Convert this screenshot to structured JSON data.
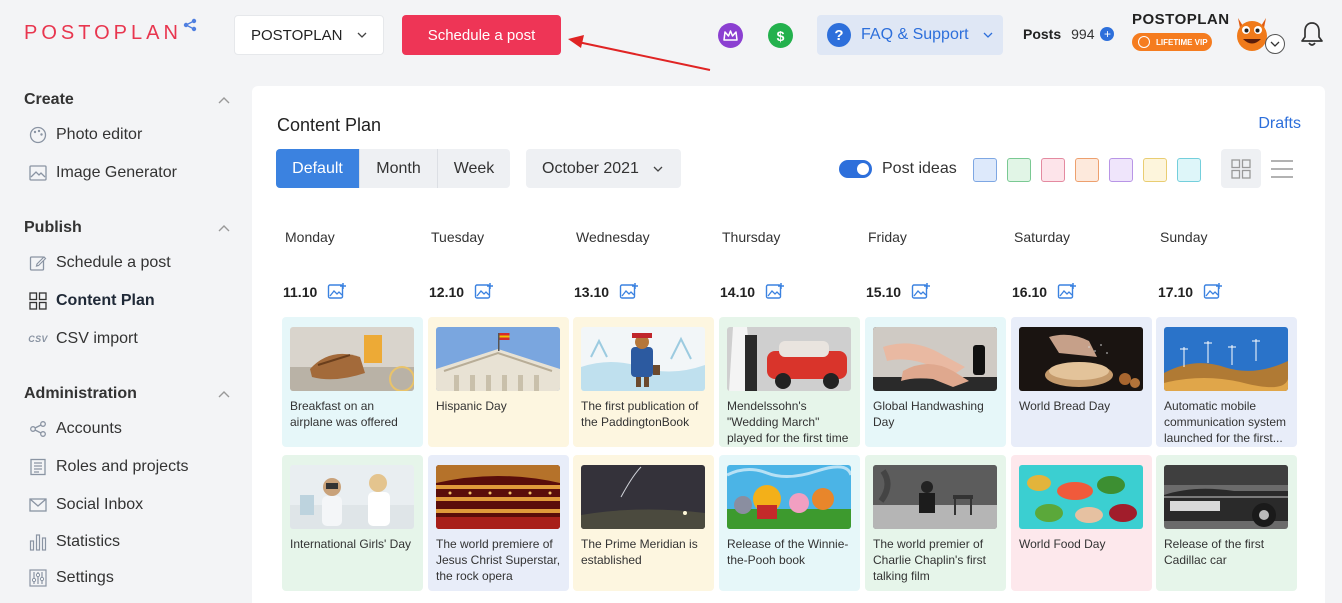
{
  "header": {
    "logo": "POSTOPLAN",
    "project_select": "POSTOPLAN",
    "schedule_button": "Schedule a post",
    "faq_label": "FAQ & Support",
    "posts_label": "Posts",
    "posts_count": "994",
    "brand_name": "POSTOPLAN",
    "vip_badge": "LIFETIME VIP"
  },
  "sidebar": {
    "create": {
      "title": "Create",
      "items": [
        "Photo editor",
        "Image Generator"
      ]
    },
    "publish": {
      "title": "Publish",
      "items": [
        "Schedule a post",
        "Content Plan",
        "CSV import"
      ]
    },
    "administration": {
      "title": "Administration",
      "items": [
        "Accounts",
        "Roles and projects",
        "Social Inbox",
        "Statistics",
        "Settings"
      ]
    },
    "csv_icon_text": "CSV"
  },
  "content": {
    "title": "Content Plan",
    "drafts": "Drafts",
    "tabs": [
      "Default",
      "Month",
      "Week"
    ],
    "month": "October 2021",
    "post_ideas": "Post ideas",
    "swatches": [
      {
        "fill": "#dde9fb",
        "border": "#7ea7e3"
      },
      {
        "fill": "#e1f5e6",
        "border": "#7ac993"
      },
      {
        "fill": "#fde4ea",
        "border": "#e48aa0"
      },
      {
        "fill": "#fde9dc",
        "border": "#eda06e"
      },
      {
        "fill": "#efe5fb",
        "border": "#b895e6"
      },
      {
        "fill": "#fdf5dc",
        "border": "#e9cd72"
      },
      {
        "fill": "#def6f9",
        "border": "#74cfdc"
      }
    ],
    "days": [
      {
        "name": "Monday",
        "date": "11.10"
      },
      {
        "name": "Tuesday",
        "date": "12.10"
      },
      {
        "name": "Wednesday",
        "date": "13.10"
      },
      {
        "name": "Thursday",
        "date": "14.10"
      },
      {
        "name": "Friday",
        "date": "15.10"
      },
      {
        "name": "Saturday",
        "date": "16.10"
      },
      {
        "name": "Sunday",
        "date": "17.10"
      }
    ],
    "row1": [
      {
        "caption": "Breakfast on an airplane was offered",
        "bg": "#e6f7f9"
      },
      {
        "caption": "Hispanic Day",
        "bg": "#fdf6e0"
      },
      {
        "caption": "The first publication of the PaddingtonBook",
        "bg": "#fdf6e0"
      },
      {
        "caption": "Mendelssohn's \"Wedding March\" played for the first time",
        "bg": "#e6f5ea"
      },
      {
        "caption": "Global Handwashing Day",
        "bg": "#e6f7f9"
      },
      {
        "caption": "World Bread Day",
        "bg": "#e8edf9"
      },
      {
        "caption": "Automatic mobile communication system launched for the first...",
        "bg": "#e8edf9"
      }
    ],
    "row2": [
      {
        "caption": "International Girls' Day",
        "bg": "#e6f5ea"
      },
      {
        "caption": "The world premiere of Jesus Christ Superstar, the rock opera",
        "bg": "#e8edf9"
      },
      {
        "caption": "The Prime Meridian is established",
        "bg": "#fdf6e0"
      },
      {
        "caption": "Release of the Winnie-the-Pooh book",
        "bg": "#e6f7f9"
      },
      {
        "caption": "The world premier of Charlie Chaplin's first talking film",
        "bg": "#e6f5ea"
      },
      {
        "caption": "World Food Day",
        "bg": "#fde8ec"
      },
      {
        "caption": "Release of the first Cadillac car",
        "bg": "#e6f5ea"
      }
    ]
  }
}
